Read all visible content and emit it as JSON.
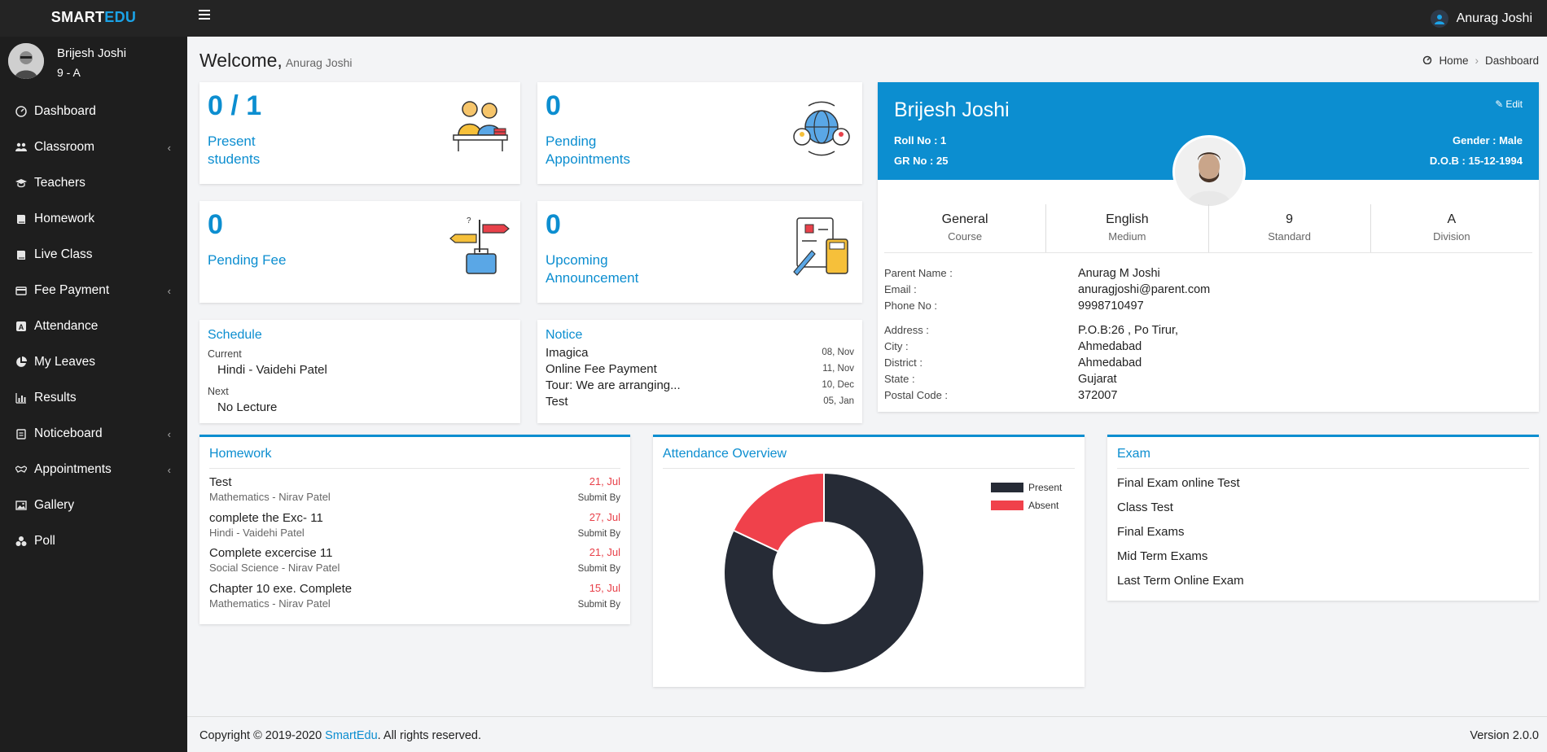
{
  "brand": {
    "part1": "SMART",
    "part2": "EDU"
  },
  "header": {
    "user_name": "Anurag Joshi"
  },
  "sidebar": {
    "student_name": "Brijesh Joshi",
    "student_class": "9 - A",
    "items": [
      {
        "label": "Dashboard",
        "icon": "dashboard-icon",
        "chevron": false
      },
      {
        "label": "Classroom",
        "icon": "users-icon",
        "chevron": true
      },
      {
        "label": "Teachers",
        "icon": "graduation-cap-icon",
        "chevron": false
      },
      {
        "label": "Homework",
        "icon": "book-icon",
        "chevron": false
      },
      {
        "label": "Live Class",
        "icon": "book-icon",
        "chevron": false
      },
      {
        "label": "Fee Payment",
        "icon": "credit-card-icon",
        "chevron": true
      },
      {
        "label": "Attendance",
        "icon": "attendance-icon",
        "chevron": false
      },
      {
        "label": "My Leaves",
        "icon": "pie-chart-icon",
        "chevron": false
      },
      {
        "label": "Results",
        "icon": "bar-chart-icon",
        "chevron": false
      },
      {
        "label": "Noticeboard",
        "icon": "clipboard-icon",
        "chevron": true
      },
      {
        "label": "Appointments",
        "icon": "handshake-icon",
        "chevron": true
      },
      {
        "label": "Gallery",
        "icon": "image-icon",
        "chevron": false
      },
      {
        "label": "Poll",
        "icon": "poll-icon",
        "chevron": false
      }
    ]
  },
  "page": {
    "welcome": "Welcome,",
    "welcome_name": "Anurag Joshi",
    "breadcrumb": {
      "home": "Home",
      "current": "Dashboard"
    }
  },
  "stats": {
    "present": {
      "value": "0 / 1",
      "label": "Present students"
    },
    "appointments": {
      "value": "0",
      "label": "Pending Appointments"
    },
    "fee": {
      "value": "0",
      "label": "Pending Fee"
    },
    "announcement": {
      "value": "0",
      "label": "Upcoming Announcement"
    }
  },
  "schedule": {
    "title": "Schedule",
    "current_label": "Current",
    "current_value": "Hindi - Vaidehi Patel",
    "next_label": "Next",
    "next_value": "No Lecture"
  },
  "notice": {
    "title": "Notice",
    "items": [
      {
        "title": "Imagica",
        "date": "08, Nov"
      },
      {
        "title": "Online Fee Payment",
        "date": "11, Nov"
      },
      {
        "title": "Tour: We are arranging...",
        "date": "10, Dec"
      },
      {
        "title": "Test",
        "date": "05, Jan"
      }
    ]
  },
  "profile": {
    "name": "Brijesh Joshi",
    "edit": "Edit",
    "roll": "Roll No : 1",
    "gr": "GR No : 25",
    "gender": "Gender : Male",
    "dob": "D.O.B : 15-12-1994",
    "stats": [
      {
        "value": "General",
        "label": "Course"
      },
      {
        "value": "English",
        "label": "Medium"
      },
      {
        "value": "9",
        "label": "Standard"
      },
      {
        "value": "A",
        "label": "Division"
      }
    ],
    "details": [
      {
        "key": "Parent Name :",
        "value": "Anurag M Joshi"
      },
      {
        "key": "Email :",
        "value": "anuragjoshi@parent.com"
      },
      {
        "key": "Phone No :",
        "value": "9998710497"
      },
      {
        "key": "Address :",
        "value": "P.O.B:26 , Po Tirur,"
      },
      {
        "key": "City :",
        "value": "Ahmedabad"
      },
      {
        "key": "District :",
        "value": "Ahmedabad"
      },
      {
        "key": "State :",
        "value": "Gujarat"
      },
      {
        "key": "Postal Code :",
        "value": "372007"
      }
    ]
  },
  "homework": {
    "title": "Homework",
    "submit_label": "Submit By",
    "items": [
      {
        "title": "Test",
        "subject": "Mathematics - Nirav Patel",
        "date": "21, Jul"
      },
      {
        "title": "complete the Exc- 11",
        "subject": "Hindi - Vaidehi Patel",
        "date": "27, Jul"
      },
      {
        "title": "Complete excercise 11",
        "subject": "Social Science - Nirav Patel",
        "date": "21, Jul"
      },
      {
        "title": "Chapter 10 exe. Complete",
        "subject": "Mathematics - Nirav Patel",
        "date": "15, Jul"
      }
    ]
  },
  "attendance": {
    "title": "Attendance Overview"
  },
  "chart_data": {
    "type": "pie",
    "categories": [
      "Present",
      "Absent"
    ],
    "values": [
      82,
      18
    ],
    "colors": [
      "#262b36",
      "#f0414b"
    ],
    "legend": "top-right"
  },
  "exam": {
    "title": "Exam",
    "items": [
      "Final Exam online Test",
      "Class Test",
      "Final Exams",
      "Mid Term Exams",
      "Last Term Online Exam"
    ]
  },
  "footer": {
    "copyright_prefix": "Copyright © 2019-2020",
    "copyright_link": "SmartEdu",
    "copyright_suffix": ". All rights reserved.",
    "version": "Version 2.0.0"
  },
  "colors": {
    "accent": "#0c8ed0",
    "sidebar": "#1e1e1e",
    "topbar": "#242424",
    "date_red": "#e8414a"
  }
}
